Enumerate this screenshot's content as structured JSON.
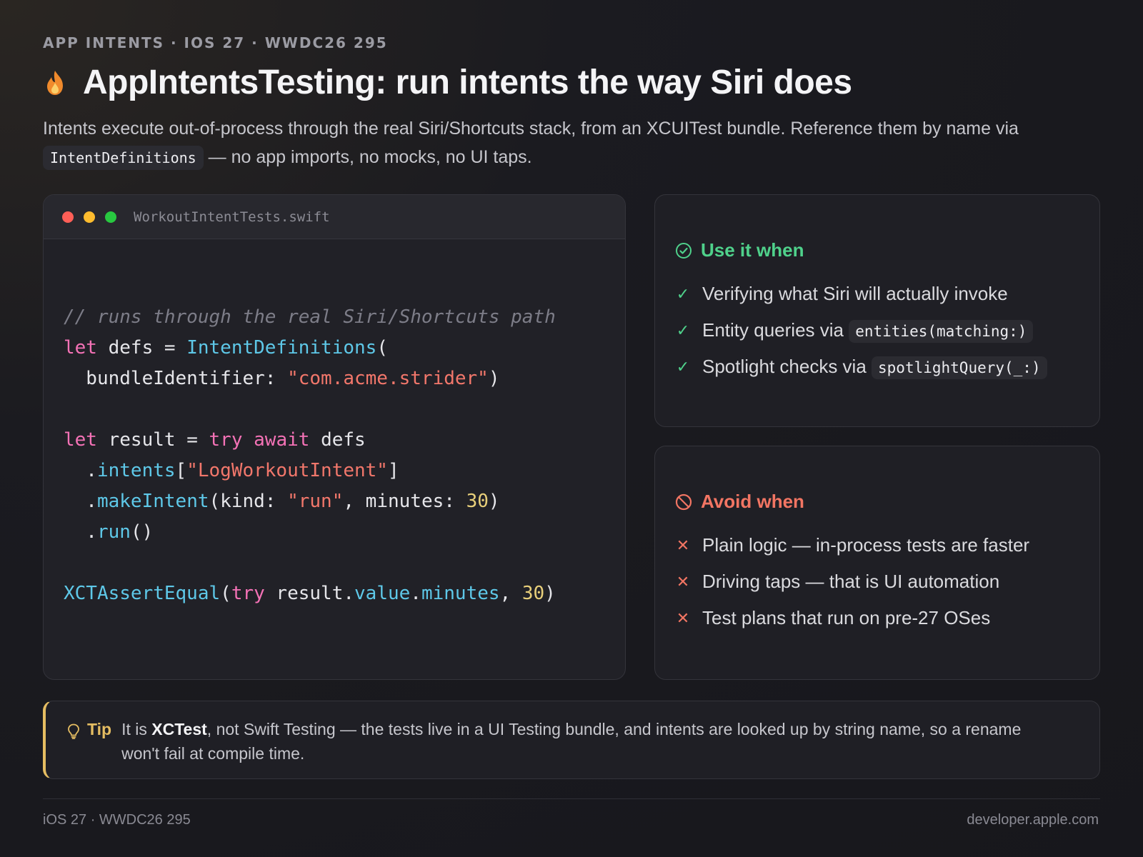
{
  "header": {
    "eyebrow": "APP INTENTS · IOS 27 · WWDC26 295",
    "title_icon": "flame-icon",
    "title": "AppIntentsTesting: run intents the way Siri does",
    "lede_part1": "Intents execute out-of-process through the real Siri/Shortcuts stack, from an XCUITest bundle. Reference them by name via ",
    "lede_code": "IntentDefinitions",
    "lede_part2": " — no app imports, no mocks, no UI taps."
  },
  "code_card": {
    "filename": "WorkoutIntentTests.swift",
    "window_dots": [
      "#ff5f57",
      "#febc2e",
      "#28c840"
    ],
    "lines": [
      [
        {
          "t": "// runs through the real Siri/Shortcuts path",
          "k": "comment"
        }
      ],
      [
        {
          "t": "let",
          "k": "kw"
        },
        {
          "t": " defs = ",
          "k": "plain"
        },
        {
          "t": "IntentDefinitions",
          "k": "type"
        },
        {
          "t": "(",
          "k": "plain"
        }
      ],
      [
        {
          "t": "  bundleIdentifier: ",
          "k": "plain"
        },
        {
          "t": "\"com.acme.strider\"",
          "k": "str"
        },
        {
          "t": ")",
          "k": "plain"
        }
      ],
      [],
      [
        {
          "t": "let",
          "k": "kw"
        },
        {
          "t": " result = ",
          "k": "plain"
        },
        {
          "t": "try",
          "k": "kw"
        },
        {
          "t": " ",
          "k": "plain"
        },
        {
          "t": "await",
          "k": "kw"
        },
        {
          "t": " defs",
          "k": "plain"
        }
      ],
      [
        {
          "t": "  .",
          "k": "plain"
        },
        {
          "t": "intents",
          "k": "prop"
        },
        {
          "t": "[",
          "k": "plain"
        },
        {
          "t": "\"LogWorkoutIntent\"",
          "k": "str"
        },
        {
          "t": "]",
          "k": "plain"
        }
      ],
      [
        {
          "t": "  .",
          "k": "plain"
        },
        {
          "t": "makeIntent",
          "k": "prop"
        },
        {
          "t": "(kind: ",
          "k": "plain"
        },
        {
          "t": "\"run\"",
          "k": "str"
        },
        {
          "t": ", minutes: ",
          "k": "plain"
        },
        {
          "t": "30",
          "k": "num"
        },
        {
          "t": ")",
          "k": "plain"
        }
      ],
      [
        {
          "t": "  .",
          "k": "plain"
        },
        {
          "t": "run",
          "k": "prop"
        },
        {
          "t": "()",
          "k": "plain"
        }
      ],
      [],
      [
        {
          "t": "XCTAssertEqual",
          "k": "type"
        },
        {
          "t": "(",
          "k": "plain"
        },
        {
          "t": "try",
          "k": "kw"
        },
        {
          "t": " result.",
          "k": "plain"
        },
        {
          "t": "value",
          "k": "prop"
        },
        {
          "t": ".",
          "k": "plain"
        },
        {
          "t": "minutes",
          "k": "prop"
        },
        {
          "t": ", ",
          "k": "plain"
        },
        {
          "t": "30",
          "k": "num"
        },
        {
          "t": ")",
          "k": "plain"
        }
      ]
    ]
  },
  "use_card": {
    "icon": "check-circle-icon",
    "title": "Use it when",
    "items": [
      {
        "text": "Verifying what Siri will actually invoke",
        "code": ""
      },
      {
        "text": "Entity queries via ",
        "code": "entities(matching:)"
      },
      {
        "text": "Spotlight checks via ",
        "code": "spotlightQuery(_:)"
      }
    ]
  },
  "avoid_card": {
    "icon": "prohibited-icon",
    "title": "Avoid when",
    "items": [
      {
        "text": "Plain logic — in-process tests are faster"
      },
      {
        "text": "Driving taps — that is UI automation"
      },
      {
        "text": "Test plans that run on pre-27 OSes"
      }
    ]
  },
  "tip": {
    "icon": "lightbulb-icon",
    "label": "Tip",
    "text_before": "It is ",
    "text_bold": "XCTest",
    "text_after": ", not Swift Testing — the tests live in a UI Testing bundle, and intents are looked up by string name, so a rename won't fail at compile time."
  },
  "footer": {
    "left": "iOS 27 · WWDC26 295",
    "right": "developer.apple.com"
  },
  "colors": {
    "accent_green": "#4fd18b",
    "accent_red": "#f27563",
    "accent_gold": "#e5bd62"
  }
}
